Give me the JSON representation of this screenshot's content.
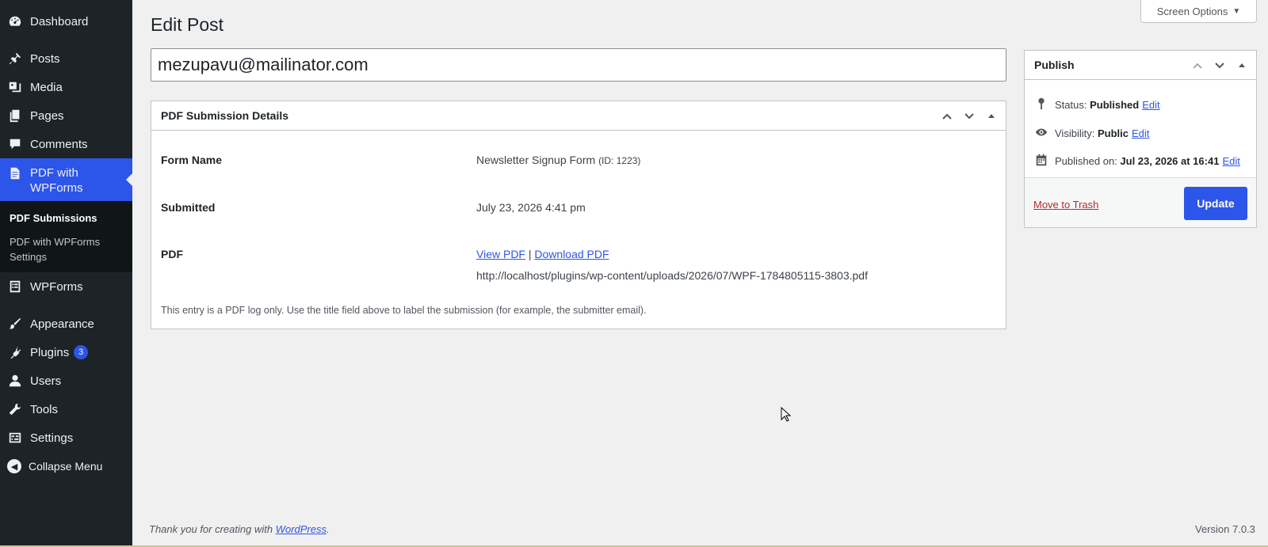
{
  "sidebar": {
    "items": [
      {
        "label": "Dashboard",
        "icon": "dashboard-icon"
      },
      {
        "label": "Posts",
        "icon": "pin-icon"
      },
      {
        "label": "Media",
        "icon": "media-icon"
      },
      {
        "label": "Pages",
        "icon": "pages-icon"
      },
      {
        "label": "Comments",
        "icon": "comment-icon"
      },
      {
        "label": "PDF with WPForms",
        "icon": "pdf-document-icon"
      },
      {
        "label": "WPForms",
        "icon": "forms-icon"
      },
      {
        "label": "Appearance",
        "icon": "brush-icon"
      },
      {
        "label": "Plugins",
        "icon": "plug-icon",
        "badge": "3"
      },
      {
        "label": "Users",
        "icon": "user-icon"
      },
      {
        "label": "Tools",
        "icon": "wrench-icon"
      },
      {
        "label": "Settings",
        "icon": "settings-icon"
      }
    ],
    "submenu": [
      "PDF Submissions",
      "PDF with WPForms Settings"
    ],
    "collapse_label": "Collapse Menu"
  },
  "header": {
    "screen_options": "Screen Options",
    "page_title": "Edit Post"
  },
  "post": {
    "title_value": "mezupavu@mailinator.com"
  },
  "details": {
    "box_title": "PDF Submission Details",
    "form_name_label": "Form Name",
    "form_name_value": "Newsletter Signup Form",
    "form_id": "(ID: 1223)",
    "submitted_label": "Submitted",
    "submitted_value": "July 23, 2026 4:41 pm",
    "pdf_label": "PDF",
    "view_pdf": "View PDF",
    "separator": "|",
    "download_pdf": "Download PDF",
    "pdf_url": "http://localhost/plugins/wp-content/uploads/2026/07/WPF-1784805115-3803.pdf",
    "note": "This entry is a PDF log only. Use the title field above to label the submission (for example, the submitter email)."
  },
  "publish": {
    "box_title": "Publish",
    "status_label": "Status:",
    "status_value": "Published",
    "visibility_label": "Visibility:",
    "visibility_value": "Public",
    "published_label": "Published on:",
    "published_value": "Jul 23, 2026 at 16:41",
    "edit_label": "Edit",
    "trash_label": "Move to Trash",
    "update_label": "Update"
  },
  "footer": {
    "thanks_prefix": "Thank you for creating with",
    "thanks_link": "WordPress",
    "thanks_suffix": ".",
    "version": "Version 7.0.3"
  },
  "colors": {
    "accent": "#2c55e9",
    "sidebar_bg": "#1d2327",
    "trash": "#b32d2e"
  }
}
